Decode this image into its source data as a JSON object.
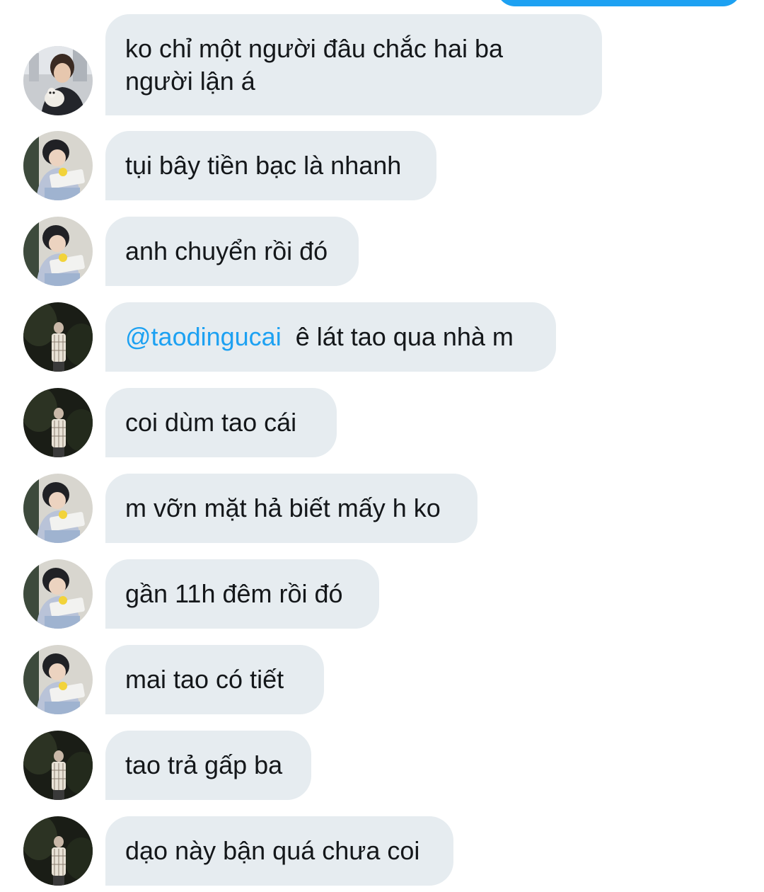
{
  "colors": {
    "sent_bubble": "#1da1f2",
    "received_bubble": "#e6ecf0",
    "mention": "#1da1f2",
    "text": "#14171a"
  },
  "messages": [
    {
      "sender_avatar": "avatar-boy-with-dog",
      "text": "ko chỉ một người đâu chắc hai ba\nngười lận á"
    },
    {
      "sender_avatar": "avatar-boy-reading",
      "text": "tụi bây tiền bạc là nhanh"
    },
    {
      "sender_avatar": "avatar-boy-reading",
      "text": "anh chuyển rồi đó"
    },
    {
      "sender_avatar": "avatar-standing-night",
      "mention": "@taodingucai",
      "text": "ê lát tao qua nhà m"
    },
    {
      "sender_avatar": "avatar-standing-night",
      "text": "coi dùm tao cái"
    },
    {
      "sender_avatar": "avatar-boy-reading",
      "text": "m vỡn mặt hả biết mấy h ko"
    },
    {
      "sender_avatar": "avatar-boy-reading",
      "text": "gần 11h đêm rồi đó"
    },
    {
      "sender_avatar": "avatar-boy-reading",
      "text": "mai tao có tiết"
    },
    {
      "sender_avatar": "avatar-standing-night",
      "text": "tao trả gấp ba"
    },
    {
      "sender_avatar": "avatar-standing-night",
      "text": "dạo này bận quá chưa coi"
    }
  ]
}
